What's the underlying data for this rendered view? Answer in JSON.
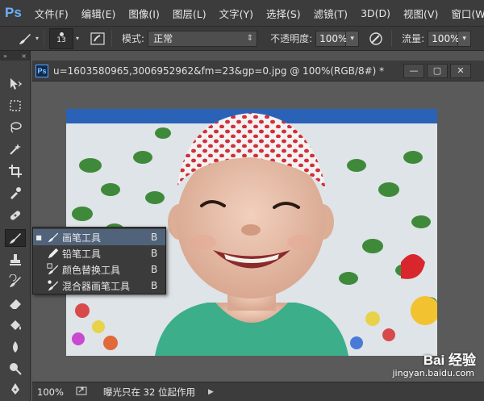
{
  "app": {
    "logo": "Ps"
  },
  "menu": [
    "文件(F)",
    "编辑(E)",
    "图像(I)",
    "图层(L)",
    "文字(Y)",
    "选择(S)",
    "滤镜(T)",
    "3D(D)",
    "视图(V)",
    "窗口(W)"
  ],
  "options": {
    "brush_size": "13",
    "mode_label": "模式:",
    "mode_value": "正常",
    "opacity_label": "不透明度:",
    "opacity_value": "100%",
    "flow_label": "流量:",
    "flow_value": "100%"
  },
  "document": {
    "title": "u=1603580965,3006952962&fm=23&gp=0.jpg @ 100%(RGB/8#) *"
  },
  "flyout": [
    {
      "label": "画笔工具",
      "key": "B",
      "selected": true,
      "icon": "brush-icon"
    },
    {
      "label": "铅笔工具",
      "key": "B",
      "selected": false,
      "icon": "pencil-icon"
    },
    {
      "label": "颜色替换工具",
      "key": "B",
      "selected": false,
      "icon": "color-replace-icon"
    },
    {
      "label": "混合器画笔工具",
      "key": "B",
      "selected": false,
      "icon": "mixer-brush-icon"
    }
  ],
  "status": {
    "zoom": "100%",
    "message": "曝光只在 32 位起作用"
  },
  "watermark": {
    "brand": "Bai 经验",
    "url": "jingyan.baidu.com"
  },
  "colors": {
    "accent": "#50637a",
    "logo_blue": "#6cb0ff"
  }
}
